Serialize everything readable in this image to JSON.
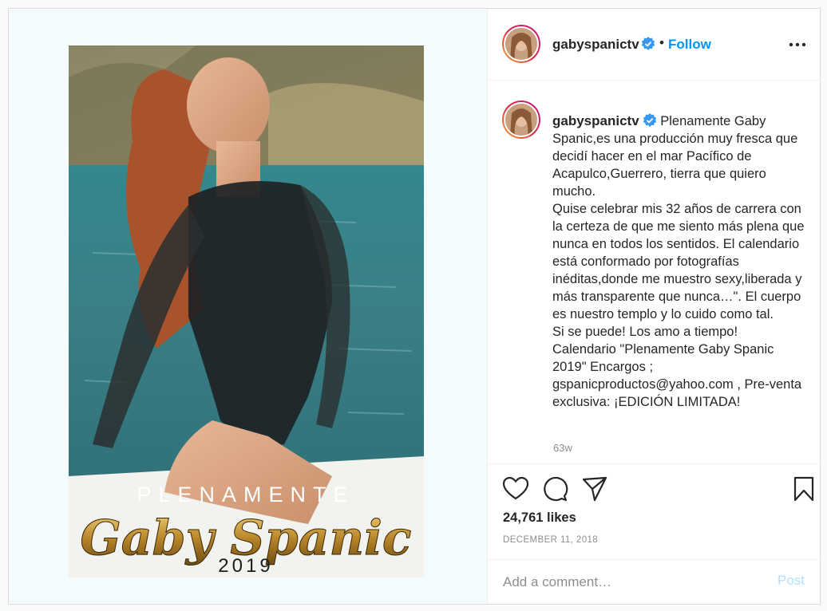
{
  "colors": {
    "accent": "#0095f6",
    "text": "#262626",
    "muted": "#8e8e8e",
    "border": "#dbdbdb",
    "post_disabled": "#b2dffc",
    "verified": "#3897f0"
  },
  "post": {
    "image": {
      "description_icon": "photo",
      "title_top": "PLENAMENTE",
      "title_script": "Gaby Spanic",
      "year": "2019"
    },
    "header": {
      "username": "gabyspanictv",
      "verified_icon": "verified-badge-icon",
      "separator": "•",
      "follow_label": "Follow",
      "more_icon": "more-options-icon"
    },
    "caption": {
      "username": "gabyspanictv",
      "text": " Plenamente Gaby Spanic,es una producción muy fresca que decidí hacer en el mar Pacífico de Acapulco,Guerrero, tierra que quiero mucho.\nQuise celebrar mis 32 años de carrera con la certeza de que me siento más plena que nunca en todos los sentidos. El calendario está conformado por fotografías inéditas,donde me muestro sexy,liberada y más transparente que nunca…\". El cuerpo es nuestro templo y lo cuido como tal.\nSi se puede! Los amo a tiempo!\nCalendario \"Plenamente Gaby Spanic 2019\" Encargos ; gspanicproductos@yahoo.com , Pre-venta exclusiva: ¡EDICIÓN LIMITADA!",
      "time_ago": "63w"
    },
    "actions": {
      "like_icon": "heart-icon",
      "comment_icon": "comment-icon",
      "share_icon": "share-icon",
      "save_icon": "bookmark-icon",
      "likes": "24,761 likes",
      "date": "DECEMBER 11, 2018"
    },
    "comment": {
      "placeholder": "Add a comment…",
      "post_label": "Post"
    }
  }
}
